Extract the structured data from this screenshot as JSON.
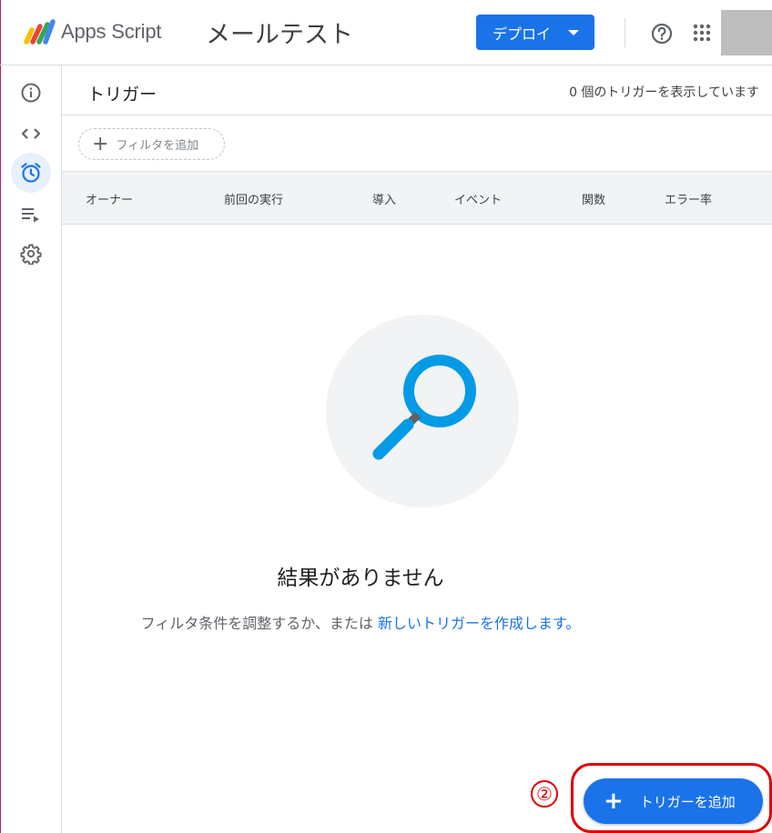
{
  "header": {
    "brand": "Apps Script",
    "project_title": "メールテスト",
    "deploy_label": "デプロイ"
  },
  "rail": {
    "items": [
      {
        "name": "overview",
        "icon": "info-icon"
      },
      {
        "name": "editor",
        "icon": "code-icon"
      },
      {
        "name": "triggers",
        "icon": "alarm-icon",
        "active": true
      },
      {
        "name": "executions",
        "icon": "executions-icon"
      },
      {
        "name": "settings",
        "icon": "gear-icon"
      }
    ]
  },
  "main": {
    "title": "トリガー",
    "trigger_count": "0 個のトリガーを表示しています",
    "filter_label": "フィルタを追加",
    "columns": [
      "オーナー",
      "前回の実行",
      "導入",
      "イベント",
      "関数",
      "エラー率"
    ],
    "empty_title": "結果がありません",
    "empty_msg_prefix": "フィルタ条件を調整するか、または",
    "empty_msg_link": "新しいトリガーを作成します。"
  },
  "fab": {
    "label": "トリガーを追加"
  },
  "annotation": {
    "step_number": "②",
    "color": "#e00000"
  },
  "colors": {
    "accent": "#1a73e8",
    "search_icon": "#039be5"
  }
}
